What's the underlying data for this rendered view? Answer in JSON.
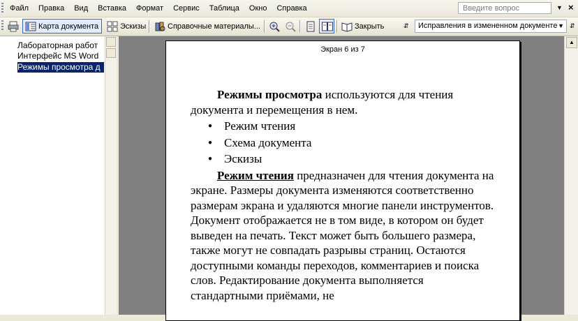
{
  "menubar": {
    "items": [
      "Файл",
      "Правка",
      "Вид",
      "Вставка",
      "Формат",
      "Сервис",
      "Таблица",
      "Окно",
      "Справка"
    ],
    "help_placeholder": "Введите вопрос"
  },
  "toolbar": {
    "document_map": "Карта документа",
    "thumbnails": "Эскизы",
    "research": "Справочные материалы...",
    "close": "Закрыть",
    "markup_combo": "Исправления в измененном документе"
  },
  "docmap": {
    "items": [
      "Лабораторная работ",
      "Интерфейс MS Word",
      "Режимы просмотра д"
    ]
  },
  "page": {
    "counter": "Экран 6 из 7",
    "p1_bold": "Режимы просмотра",
    "p1_rest": " используются для чтения документа и перемещения в нем.",
    "bullets": [
      "Режим чтения",
      "Схема документа",
      "Эскизы"
    ],
    "p2_bold": "Режим чтения",
    "p2_rest": " предназначен для чтения документа на экране. Размеры документа изменяются соответственно размерам экрана и удаляются многие панели инструментов. Документ отображается не в том виде, в котором он будет выведен на печать. Текст может быть большего размера, также могут не совпадать разрывы страниц. Остаются доступными команды переходов, комментариев и поиска слов. Редактирование документа выполняется стандартными приёмами, не"
  }
}
